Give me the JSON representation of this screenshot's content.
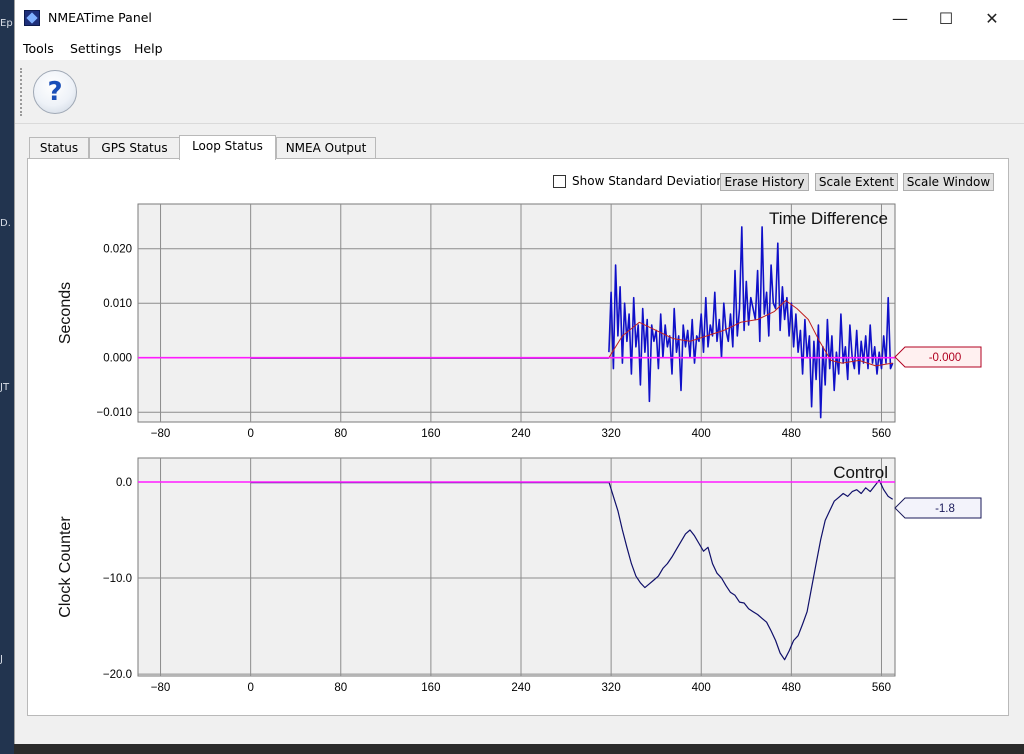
{
  "window": {
    "title": "NMEATime Panel",
    "minimize": "—",
    "maximize": "☐",
    "close": "✕"
  },
  "menu": [
    "Tools",
    "Settings",
    "Help"
  ],
  "toolbar": {
    "help_glyph": "?"
  },
  "tabs": [
    {
      "label": "Status",
      "active": false
    },
    {
      "label": "GPS Status",
      "active": false
    },
    {
      "label": "Loop Status",
      "active": true
    },
    {
      "label": "NMEA Output",
      "active": false
    }
  ],
  "controls": {
    "show_std_label": "Show Standard Deviation",
    "show_std_checked": false,
    "erase_history": "Erase History",
    "scale_extent": "Scale Extent",
    "scale_window": "Scale Window"
  },
  "desktop_fragments": [
    "Ep",
    "D.",
    "JT",
    "J"
  ],
  "colors": {
    "series_blue": "#1010c8",
    "smooth_red": "#c02020",
    "zero_line": "#ff1aff",
    "control_line": "#10106a",
    "grid": "#8c8c8c",
    "plot_bg": "#f0f0f0",
    "marker_red": "#b00020",
    "marker_navy": "#1a1a5a"
  },
  "chart_data": [
    {
      "type": "line",
      "title": "Time Difference",
      "ylabel": "Seconds",
      "xlabel": "",
      "xlim": [
        -100,
        572
      ],
      "ylim": [
        -0.0118,
        0.0282
      ],
      "x_ticks": [
        -80,
        0,
        80,
        160,
        240,
        320,
        400,
        480,
        560
      ],
      "y_ticks": [
        0.02,
        0.01,
        0.0,
        -0.01
      ],
      "y_tick_labels": [
        "0.020",
        "0.010",
        "0.000",
        "−0.010"
      ],
      "reference_line": 0.0,
      "current_value_label": "-0.000",
      "series": [
        {
          "role": "raw",
          "x": [
            318,
            320,
            322,
            324,
            326,
            328,
            330,
            332,
            334,
            336,
            338,
            340,
            342,
            344,
            346,
            348,
            350,
            352,
            354,
            356,
            358,
            360,
            362,
            364,
            366,
            368,
            370,
            372,
            374,
            376,
            378,
            380,
            382,
            384,
            386,
            388,
            390,
            392,
            394,
            396,
            398,
            400,
            402,
            404,
            406,
            408,
            410,
            412,
            414,
            416,
            418,
            420,
            422,
            424,
            426,
            428,
            430,
            432,
            434,
            436,
            438,
            440,
            442,
            444,
            446,
            448,
            450,
            452,
            454,
            456,
            458,
            460,
            462,
            464,
            466,
            468,
            470,
            472,
            474,
            476,
            478,
            480,
            482,
            484,
            486,
            488,
            490,
            492,
            494,
            496,
            498,
            500,
            502,
            504,
            506,
            508,
            510,
            512,
            514,
            516,
            518,
            520,
            522,
            524,
            526,
            528,
            530,
            532,
            534,
            536,
            538,
            540,
            542,
            544,
            546,
            548,
            550,
            552,
            554,
            556,
            558,
            560,
            562,
            564,
            566,
            568,
            570
          ],
          "y": [
            0.001,
            0.012,
            -0.002,
            0.017,
            0.004,
            0.013,
            -0.001,
            0.01,
            0.003,
            0.008,
            -0.003,
            0.011,
            0.002,
            0.006,
            -0.005,
            0.009,
            0.001,
            0.007,
            -0.008,
            0.006,
            0.003,
            0.005,
            -0.002,
            0.008,
            0.0,
            0.006,
            0.002,
            0.004,
            -0.003,
            0.009,
            0.001,
            0.004,
            -0.006,
            0.006,
            0.002,
            0.005,
            0.0,
            0.007,
            -0.001,
            0.004,
            0.003,
            0.008,
            0.001,
            0.011,
            0.002,
            0.006,
            0.004,
            0.012,
            0.003,
            0.007,
            0.0,
            0.01,
            0.005,
            0.003,
            0.008,
            0.002,
            0.016,
            0.004,
            0.009,
            0.024,
            0.005,
            0.014,
            0.006,
            0.011,
            0.009,
            0.007,
            0.016,
            0.003,
            0.024,
            0.008,
            0.012,
            0.004,
            0.017,
            0.01,
            0.009,
            0.021,
            0.005,
            0.013,
            0.007,
            0.011,
            0.004,
            0.01,
            0.002,
            0.008,
            0.001,
            0.005,
            -0.003,
            0.007,
            0.0,
            0.004,
            -0.009,
            0.003,
            -0.004,
            0.006,
            -0.011,
            0.002,
            -0.005,
            0.007,
            -0.002,
            0.004,
            -0.006,
            0.001,
            -0.003,
            0.008,
            -0.001,
            0.002,
            -0.004,
            0.006,
            0.0,
            -0.002,
            0.005,
            -0.003,
            0.003,
            -0.001,
            0.004,
            -0.002,
            0.006,
            -0.001,
            0.002,
            -0.003,
            0.001,
            -0.002,
            0.004,
            -0.001,
            0.011,
            -0.002,
            -0.001
          ]
        },
        {
          "role": "smoothed",
          "x": [
            318,
            330,
            345,
            360,
            375,
            390,
            405,
            420,
            435,
            450,
            465,
            475,
            485,
            495,
            505,
            515,
            525,
            540,
            555,
            570
          ],
          "y": [
            0.0,
            0.004,
            0.0065,
            0.005,
            0.0035,
            0.003,
            0.004,
            0.005,
            0.0065,
            0.007,
            0.0085,
            0.0105,
            0.009,
            0.007,
            0.003,
            -0.0005,
            -0.001,
            -0.0005,
            -0.0015,
            -0.001
          ]
        }
      ]
    },
    {
      "type": "line",
      "title": "Control",
      "ylabel": "Clock Counter",
      "xlabel": "",
      "xlim": [
        -100,
        572
      ],
      "ylim": [
        -20.2,
        2.5
      ],
      "x_ticks": [
        -80,
        0,
        80,
        160,
        240,
        320,
        400,
        480,
        560
      ],
      "y_ticks": [
        0.0,
        -10.0,
        -20.0
      ],
      "y_tick_labels": [
        "0.0",
        "−10.0",
        "−20.0"
      ],
      "reference_line": 0.0,
      "current_value_label": "-1.8",
      "series": [
        {
          "role": "control",
          "x": [
            318,
            322,
            326,
            330,
            334,
            338,
            342,
            346,
            350,
            354,
            358,
            362,
            366,
            370,
            374,
            378,
            382,
            386,
            390,
            394,
            398,
            402,
            406,
            410,
            414,
            418,
            422,
            426,
            430,
            434,
            438,
            442,
            446,
            450,
            454,
            458,
            462,
            466,
            470,
            474,
            478,
            482,
            486,
            490,
            494,
            498,
            502,
            506,
            510,
            514,
            518,
            522,
            526,
            530,
            534,
            538,
            542,
            546,
            550,
            554,
            558,
            562,
            566,
            570
          ],
          "y": [
            0.0,
            -1.5,
            -3.0,
            -5.0,
            -6.8,
            -8.5,
            -9.8,
            -10.5,
            -11.0,
            -10.6,
            -10.2,
            -9.8,
            -9.0,
            -8.5,
            -7.8,
            -7.0,
            -6.2,
            -5.4,
            -5.0,
            -5.6,
            -6.4,
            -7.2,
            -6.8,
            -8.5,
            -9.5,
            -10.0,
            -10.8,
            -11.5,
            -11.8,
            -12.5,
            -12.6,
            -13.2,
            -13.5,
            -13.8,
            -14.2,
            -14.6,
            -15.5,
            -16.5,
            -17.8,
            -18.5,
            -17.6,
            -16.5,
            -16.0,
            -14.8,
            -13.5,
            -11.0,
            -8.5,
            -6.0,
            -4.0,
            -3.0,
            -2.0,
            -1.6,
            -1.2,
            -1.5,
            -1.0,
            -0.8,
            -1.2,
            -0.6,
            -1.0,
            -0.4,
            0.2,
            -0.8,
            -1.5,
            -1.8
          ]
        }
      ]
    }
  ]
}
